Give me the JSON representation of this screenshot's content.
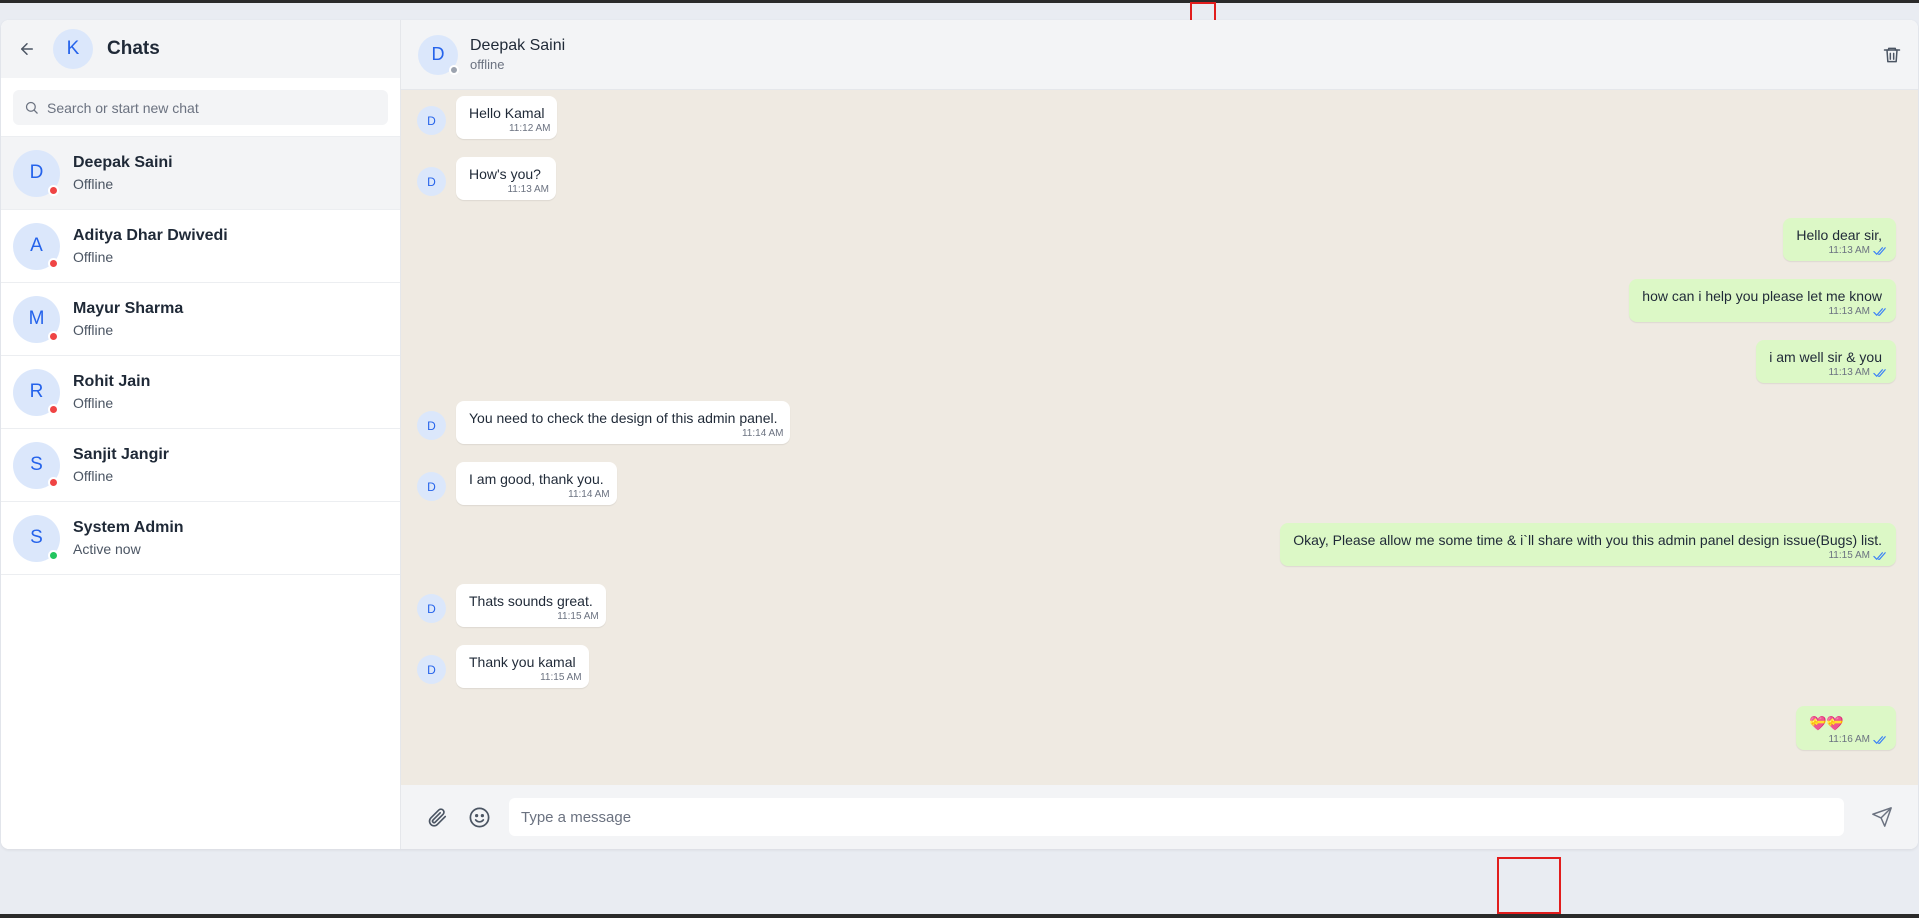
{
  "sidebar": {
    "title": "Chats",
    "my_initial": "K",
    "search_placeholder": "Search or start new chat",
    "contacts": [
      {
        "initial": "D",
        "name": "Deepak Saini",
        "status": "Offline",
        "status_color": "#ef4444",
        "active": true
      },
      {
        "initial": "A",
        "name": "Aditya Dhar Dwivedi",
        "status": "Offline",
        "status_color": "#ef4444",
        "active": false
      },
      {
        "initial": "M",
        "name": "Mayur Sharma",
        "status": "Offline",
        "status_color": "#ef4444",
        "active": false
      },
      {
        "initial": "R",
        "name": "Rohit Jain",
        "status": "Offline",
        "status_color": "#ef4444",
        "active": false
      },
      {
        "initial": "S",
        "name": "Sanjit Jangir",
        "status": "Offline",
        "status_color": "#ef4444",
        "active": false
      },
      {
        "initial": "S",
        "name": "System Admin",
        "status": "Active now",
        "status_color": "#22c55e",
        "active": false
      }
    ]
  },
  "chat": {
    "contact_initial": "D",
    "contact_name": "Deepak Saini",
    "contact_status": "offline",
    "status_color": "#9ca3af",
    "messages": [
      {
        "dir": "in",
        "text": "Hello Kamal",
        "time": "11:12 AM"
      },
      {
        "dir": "in",
        "text": "How's you?",
        "time": "11:13 AM"
      },
      {
        "dir": "out",
        "text": "Hello dear sir,",
        "time": "11:13 AM"
      },
      {
        "dir": "out",
        "text": "how can i help you please let me know",
        "time": "11:13 AM"
      },
      {
        "dir": "out",
        "text": "i am well sir & you",
        "time": "11:13 AM"
      },
      {
        "dir": "in",
        "text": "You need to check the design of this admin panel.",
        "time": "11:14 AM"
      },
      {
        "dir": "in",
        "text": "I am good, thank you.",
        "time": "11:14 AM"
      },
      {
        "dir": "out",
        "text": "Okay, Please allow me some time & i`ll share with you this admin panel design issue(Bugs) list.",
        "time": "11:15 AM"
      },
      {
        "dir": "in",
        "text": "Thats sounds great.",
        "time": "11:15 AM"
      },
      {
        "dir": "in",
        "text": "Thank you kamal",
        "time": "11:15 AM"
      },
      {
        "dir": "out",
        "text": "💝💝",
        "time": "11:16 AM"
      }
    ]
  },
  "composer": {
    "placeholder": "Type a message"
  },
  "colors": {
    "accent": "#2563eb",
    "outgoing_bubble": "#dcf8c6",
    "chat_background": "#efeae2",
    "tick": "#3b82f6"
  },
  "icons": {
    "back": "arrow-left-icon",
    "search": "search-icon",
    "delete": "trash-icon",
    "attach": "paperclip-icon",
    "emoji": "smiley-icon",
    "send": "send-icon",
    "read": "double-check-icon"
  }
}
